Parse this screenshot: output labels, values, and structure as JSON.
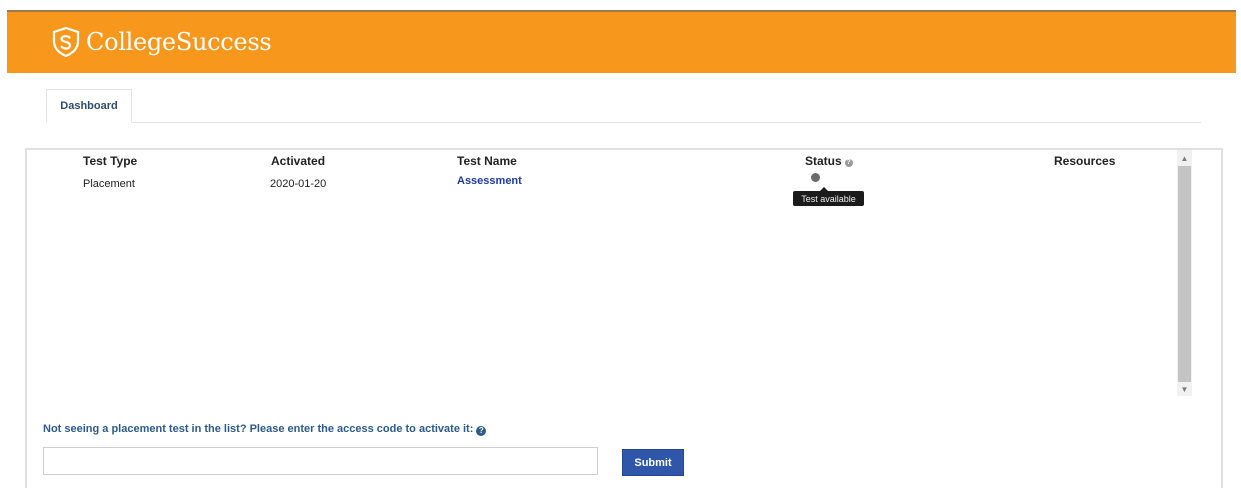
{
  "header": {
    "brand_name": "CollegeSuccess",
    "brand_color": "#f7981d",
    "logo_icon": "shield-icon"
  },
  "tabs": [
    {
      "label": "Dashboard",
      "active": true
    }
  ],
  "table": {
    "columns": [
      "Test Type",
      "Activated",
      "Test Name",
      "Status",
      "Resources"
    ],
    "status_help_icon": "help-icon",
    "rows": [
      {
        "test_type": "Placement",
        "activated": "2020-01-20",
        "test_name": "Assessment",
        "status_icon": "status-dot-icon",
        "status_tooltip": "Test available",
        "resources": ""
      }
    ]
  },
  "access_code": {
    "prompt": "Not seeing a placement test in the list? Please enter the access code to activate it:",
    "help_icon": "question-icon",
    "input_value": "",
    "input_placeholder": "",
    "submit_label": "Submit",
    "submit_color": "#2f56a8"
  }
}
